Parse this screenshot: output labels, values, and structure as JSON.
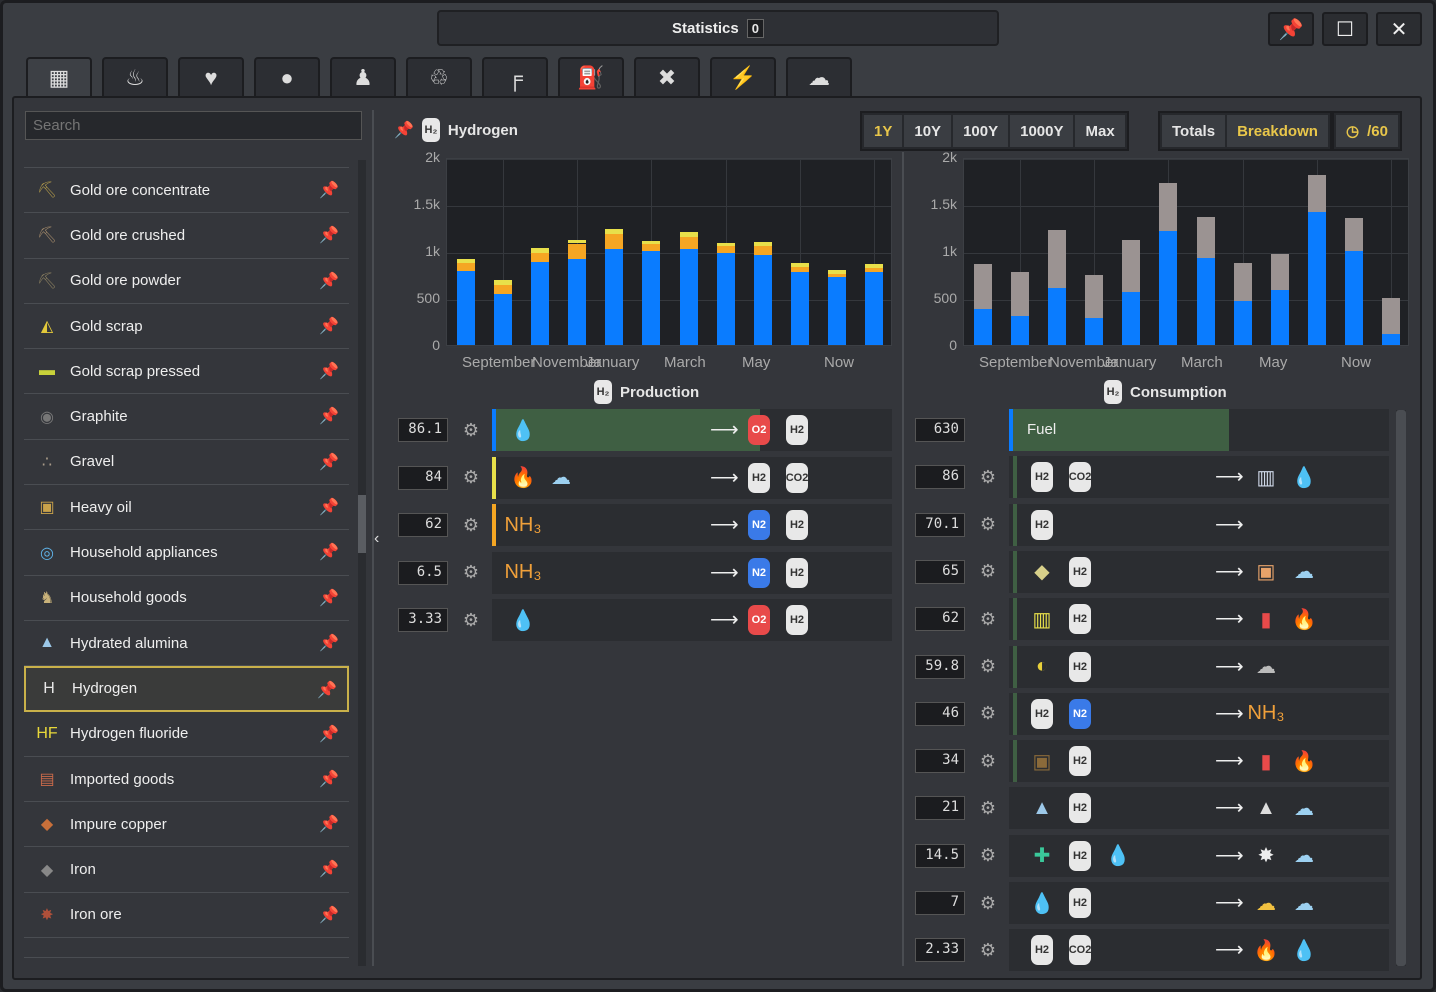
{
  "window": {
    "title": "Statistics",
    "badge": "0"
  },
  "tabs": [
    {
      "icon": "factory-icon",
      "glyph": "▦"
    },
    {
      "icon": "food-icon",
      "glyph": "♨"
    },
    {
      "icon": "health-icon",
      "glyph": "♥"
    },
    {
      "icon": "person-icon",
      "glyph": "●"
    },
    {
      "icon": "worker-icon",
      "glyph": "♟"
    },
    {
      "icon": "recycle-icon",
      "glyph": "♲"
    },
    {
      "icon": "pipe-icon",
      "glyph": "╒"
    },
    {
      "icon": "fuel-icon",
      "glyph": "⛽"
    },
    {
      "icon": "tools-icon",
      "glyph": "✖"
    },
    {
      "icon": "power-icon",
      "glyph": "⚡"
    },
    {
      "icon": "pollution-icon",
      "glyph": "☁"
    }
  ],
  "search": {
    "placeholder": "Search"
  },
  "products": [
    {
      "name": "Gold ore concentrate",
      "icon": "gold-ore-concentrate-icon",
      "glyph": "⛏",
      "color": "#b29a4a"
    },
    {
      "name": "Gold ore crushed",
      "icon": "gold-ore-crushed-icon",
      "glyph": "⛏",
      "color": "#a38a6a"
    },
    {
      "name": "Gold ore powder",
      "icon": "gold-ore-powder-icon",
      "glyph": "⛏",
      "color": "#8c8060"
    },
    {
      "name": "Gold scrap",
      "icon": "gold-scrap-icon",
      "glyph": "◭",
      "color": "#e2c83a"
    },
    {
      "name": "Gold scrap pressed",
      "icon": "gold-scrap-pressed-icon",
      "glyph": "▬",
      "color": "#c8d23a"
    },
    {
      "name": "Graphite",
      "icon": "graphite-icon",
      "glyph": "◉",
      "color": "#777"
    },
    {
      "name": "Gravel",
      "icon": "gravel-icon",
      "glyph": "∴",
      "color": "#a89a88"
    },
    {
      "name": "Heavy oil",
      "icon": "heavy-oil-icon",
      "glyph": "▣",
      "color": "#c9a24a"
    },
    {
      "name": "Household appliances",
      "icon": "household-appliances-icon",
      "glyph": "◎",
      "color": "#5fb3e8"
    },
    {
      "name": "Household goods",
      "icon": "household-goods-icon",
      "glyph": "♞",
      "color": "#c9b27a"
    },
    {
      "name": "Hydrated alumina",
      "icon": "hydrated-alumina-icon",
      "glyph": "▲",
      "color": "#9cc8e8"
    },
    {
      "name": "Hydrogen",
      "icon": "hydrogen-icon",
      "glyph": "H",
      "color": "#e8e8e8"
    },
    {
      "name": "Hydrogen fluoride",
      "icon": "hydrogen-fluoride-icon",
      "glyph": "HF",
      "color": "#e8d83a"
    },
    {
      "name": "Imported goods",
      "icon": "imported-goods-icon",
      "glyph": "▤",
      "color": "#c96a4a"
    },
    {
      "name": "Impure copper",
      "icon": "impure-copper-icon",
      "glyph": "◆",
      "color": "#c9703a"
    },
    {
      "name": "Iron",
      "icon": "iron-icon",
      "glyph": "◆",
      "color": "#888"
    },
    {
      "name": "Iron ore",
      "icon": "iron-ore-icon",
      "glyph": "✸",
      "color": "#b0503a"
    }
  ],
  "selected": {
    "name": "Hydrogen"
  },
  "time_buttons": [
    "1Y",
    "10Y",
    "100Y",
    "1000Y",
    "Max"
  ],
  "active_time": "1Y",
  "mode_buttons": [
    "Totals",
    "Breakdown"
  ],
  "active_mode": "Breakdown",
  "rate_button": "/60",
  "sections": {
    "production": "Production",
    "consumption": "Consumption"
  },
  "fuel_label": "Fuel",
  "colors": {
    "blue": "#0a7cff",
    "orange": "#f5a623",
    "yellow": "#e8e04a",
    "gray": "#9b9392",
    "green": "#3f5f43"
  },
  "chart_data": [
    {
      "type": "bar",
      "title": "Production",
      "ylim": [
        0,
        2000
      ],
      "yticks": [
        "2k",
        "1.5k",
        "1k",
        "500",
        "0"
      ],
      "xticks": [
        "September",
        "November",
        "January",
        "March",
        "May",
        "Now"
      ],
      "series": [
        {
          "values": [
            790,
            540,
            880,
            910,
            1020,
            1000,
            1020,
            980,
            960,
            780,
            720,
            780
          ]
        },
        {
          "values": [
            80,
            100,
            100,
            170,
            160,
            70,
            130,
            70,
            90,
            50,
            40,
            40
          ]
        },
        {
          "values": [
            40,
            50,
            50,
            40,
            50,
            40,
            50,
            40,
            50,
            40,
            40,
            40
          ]
        }
      ]
    },
    {
      "type": "bar",
      "title": "Consumption",
      "ylim": [
        0,
        2000
      ],
      "yticks": [
        "2k",
        "1.5k",
        "1k",
        "500",
        "0"
      ],
      "xticks": [
        "September",
        "November",
        "January",
        "March",
        "May",
        "Now"
      ],
      "series": [
        {
          "values": [
            380,
            310,
            610,
            290,
            560,
            1210,
            930,
            470,
            580,
            1410,
            1000,
            120
          ]
        },
        {
          "values": [
            480,
            470,
            610,
            450,
            560,
            510,
            430,
            400,
            390,
            400,
            350,
            380
          ]
        }
      ]
    }
  ],
  "production_rows": [
    {
      "value": "86.1",
      "machine": "generator-icon",
      "fill": 0.67,
      "accent": "#0a7cff",
      "inputs": [
        {
          "name": "water-icon",
          "glyph": "💧",
          "color": "#1aa3ff"
        }
      ],
      "outputs": [
        {
          "name": "oxygen-icon",
          "label": "O2",
          "color": "#e84a4a"
        },
        {
          "name": "hydrogen-icon",
          "label": "H2",
          "color": "#e8e8e8"
        }
      ]
    },
    {
      "value": "84",
      "machine": "reformer-icon",
      "fill": 0.0,
      "accent": "#e8e04a",
      "inputs": [
        {
          "name": "fuel-gas-icon",
          "glyph": "🔥",
          "color": "#f07a2a"
        },
        {
          "name": "steam-icon",
          "glyph": "☁",
          "color": "#9cd0f0"
        }
      ],
      "outputs": [
        {
          "name": "hydrogen-icon",
          "label": "H2",
          "color": "#e8e8e8"
        },
        {
          "name": "co2-icon",
          "label": "CO2",
          "color": "#e8e8e8"
        }
      ]
    },
    {
      "value": "62",
      "machine": "cracker-icon",
      "fill": 0.0,
      "accent": "#f5a623",
      "inputs": [
        {
          "name": "ammonia-icon",
          "glyph": "NH₃",
          "color": "#f0a03a"
        }
      ],
      "outputs": [
        {
          "name": "nitrogen-icon",
          "label": "N2",
          "color": "#3a7ae8"
        },
        {
          "name": "hydrogen-icon",
          "label": "H2",
          "color": "#e8e8e8"
        }
      ]
    },
    {
      "value": "6.5",
      "machine": "cracker-icon",
      "fill": 0.0,
      "accent": "#2b2d31",
      "inputs": [
        {
          "name": "ammonia-icon",
          "glyph": "NH₃",
          "color": "#f0a03a"
        }
      ],
      "outputs": [
        {
          "name": "nitrogen-icon",
          "label": "N2",
          "color": "#3a7ae8"
        },
        {
          "name": "hydrogen-icon",
          "label": "H2",
          "color": "#e8e8e8"
        }
      ]
    },
    {
      "value": "3.33",
      "machine": "electrolyzer-icon",
      "fill": 0.0,
      "accent": "#2b2d31",
      "inputs": [
        {
          "name": "water-icon",
          "glyph": "💧",
          "color": "#1aa3ff"
        }
      ],
      "outputs": [
        {
          "name": "oxygen-icon",
          "label": "O2",
          "color": "#e84a4a"
        },
        {
          "name": "hydrogen-icon",
          "label": "H2",
          "color": "#e8e8e8"
        }
      ]
    }
  ],
  "consumption_rows": [
    {
      "value": "630",
      "fuel": true,
      "fill": 0.58,
      "accent": "#0a7cff",
      "inputs": [],
      "outputs": []
    },
    {
      "value": "86",
      "fill": 0.02,
      "inputs": [
        {
          "label": "H2",
          "color": "#e8e8e8"
        },
        {
          "label": "CO2",
          "color": "#e8e8e8"
        }
      ],
      "outputs": [
        {
          "glyph": "▥",
          "color": "#cfd8e8"
        },
        {
          "glyph": "💧",
          "color": "#1aa3ff"
        }
      ]
    },
    {
      "value": "70.1",
      "fill": 0.02,
      "inputs": [
        {
          "label": "H2",
          "color": "#e8e8e8"
        }
      ],
      "outputs": []
    },
    {
      "value": "65",
      "fill": 0.02,
      "inputs": [
        {
          "glyph": "◆",
          "color": "#d8d08a"
        },
        {
          "label": "H2",
          "color": "#e8e8e8"
        }
      ],
      "outputs": [
        {
          "glyph": "▣",
          "color": "#e8a36a"
        },
        {
          "glyph": "☁",
          "color": "#9cd0f0"
        }
      ]
    },
    {
      "value": "62",
      "fill": 0.02,
      "inputs": [
        {
          "glyph": "▥",
          "color": "#e8e04a"
        },
        {
          "label": "H2",
          "color": "#e8e8e8"
        }
      ],
      "outputs": [
        {
          "glyph": "▮",
          "color": "#e84a4a"
        },
        {
          "glyph": "🔥",
          "color": "#f07a2a"
        }
      ]
    },
    {
      "value": "59.8",
      "fill": 0.02,
      "inputs": [
        {
          "glyph": "◐",
          "color": "#e8d03a"
        },
        {
          "label": "H2",
          "color": "#e8e8e8"
        }
      ],
      "outputs": [
        {
          "glyph": "☁",
          "color": "#bbb"
        }
      ]
    },
    {
      "value": "46",
      "fill": 0.02,
      "inputs": [
        {
          "label": "H2",
          "color": "#e8e8e8"
        },
        {
          "label": "N2",
          "color": "#3a7ae8"
        }
      ],
      "outputs": [
        {
          "glyph": "NH₃",
          "color": "#f0a03a"
        }
      ]
    },
    {
      "value": "34",
      "fill": 0.02,
      "inputs": [
        {
          "glyph": "▣",
          "color": "#8a6a3a"
        },
        {
          "label": "H2",
          "color": "#e8e8e8"
        }
      ],
      "outputs": [
        {
          "glyph": "▮",
          "color": "#e84a4a"
        },
        {
          "glyph": "🔥",
          "color": "#f07a2a"
        }
      ]
    },
    {
      "value": "21",
      "fill": 0.0,
      "inputs": [
        {
          "glyph": "▲",
          "color": "#9cc8e8"
        },
        {
          "label": "H2",
          "color": "#e8e8e8"
        }
      ],
      "outputs": [
        {
          "glyph": "▲",
          "color": "#ddd"
        },
        {
          "glyph": "☁",
          "color": "#9cd0f0"
        }
      ]
    },
    {
      "value": "14.5",
      "fill": 0.0,
      "inputs": [
        {
          "glyph": "✚",
          "color": "#3ac89a"
        },
        {
          "label": "H2",
          "color": "#e8e8e8"
        },
        {
          "glyph": "💧",
          "color": "#1aa3ff"
        }
      ],
      "outputs": [
        {
          "glyph": "✸",
          "color": "#eee"
        },
        {
          "glyph": "☁",
          "color": "#9cd0f0"
        }
      ]
    },
    {
      "value": "7",
      "fill": 0.0,
      "inputs": [
        {
          "glyph": "💧",
          "color": "#1aa3ff"
        },
        {
          "label": "H2",
          "color": "#e8e8e8"
        }
      ],
      "outputs": [
        {
          "glyph": "☁",
          "color": "#f0c040"
        },
        {
          "glyph": "☁",
          "color": "#9cd0f0"
        }
      ]
    },
    {
      "value": "2.33",
      "fill": 0.0,
      "inputs": [
        {
          "label": "H2",
          "color": "#e8e8e8"
        },
        {
          "label": "CO2",
          "color": "#e8e8e8"
        }
      ],
      "outputs": [
        {
          "glyph": "🔥",
          "color": "#f07a2a"
        },
        {
          "glyph": "💧",
          "color": "#1aa3ff"
        }
      ]
    }
  ]
}
